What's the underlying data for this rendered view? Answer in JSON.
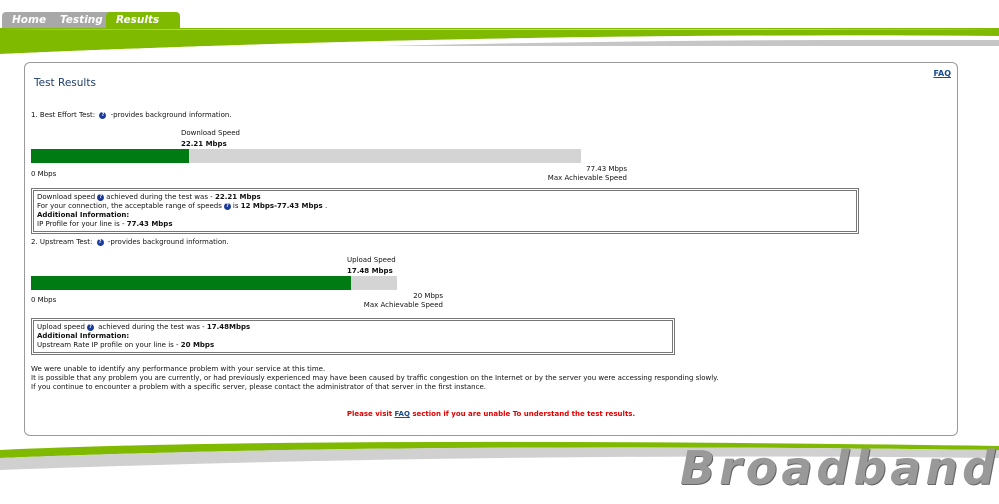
{
  "tabs": [
    {
      "label": "Home"
    },
    {
      "label": "Testing"
    },
    {
      "label": "Results",
      "active": true
    }
  ],
  "colors": {
    "accent_green": "#7fba00",
    "bar_green": "#007a12",
    "bar_grey": "#d4d4d4",
    "alert_red": "#e00000"
  },
  "panel": {
    "title": "Test Results",
    "faq_link": "FAQ"
  },
  "download": {
    "heading": "1. Best Effort Test:",
    "heading_suffix": "-provides background information.",
    "speed_label": "Download Speed",
    "speed_value": "22.21 Mbps",
    "min_label": "0 Mbps",
    "max_value": "77.43 Mbps",
    "max_label": "Max Achievable Speed",
    "fill_fraction": 0.287,
    "box_line1_prefix": "Download speed",
    "box_line1_mid": "achieved during the test was - ",
    "box_line1_value": "22.21 Mbps",
    "box_line2_prefix": "For your connection, the acceptable range of speeds",
    "box_line2_mid": "is ",
    "box_line2_value": "12 Mbps-77.43 Mbps",
    "box_line2_suffix": " .",
    "box_line3": "Additional Information:",
    "box_line4_prefix": "IP Profile for your line is - ",
    "box_line4_value": "77.43 Mbps"
  },
  "upload": {
    "heading": "2. Upstream Test:",
    "heading_suffix": "-provides background information.",
    "speed_label": "Upload Speed",
    "speed_value": "17.48 Mbps",
    "min_label": "0 Mbps",
    "max_value": "20 Mbps",
    "max_label": "Max Achievable Speed",
    "fill_fraction": 0.874,
    "box_line1_prefix": "Upload speed",
    "box_line1_mid": " achieved during the test was - ",
    "box_line1_value": "17.48Mbps",
    "box_line2": "Additional Information:",
    "box_line3_prefix": "Upstream Rate IP profile on your line is - ",
    "box_line3_value": "20 Mbps"
  },
  "notice": {
    "line1": "We were unable to identify any performance problem with your service at this time.",
    "line2": "It is possible that any problem you are currently, or had previously experienced may have been caused by traffic congestion on the Internet or by the server you were accessing responding slowly.",
    "line3": "If you continue to encounter a problem with a specific server, please contact the administrator of that server in the first instance."
  },
  "footer": {
    "prefix": "Please visit ",
    "link": "FAQ",
    "suffix": " section if you are unable To understand the test results."
  },
  "brand": {
    "text": "Broadband"
  }
}
